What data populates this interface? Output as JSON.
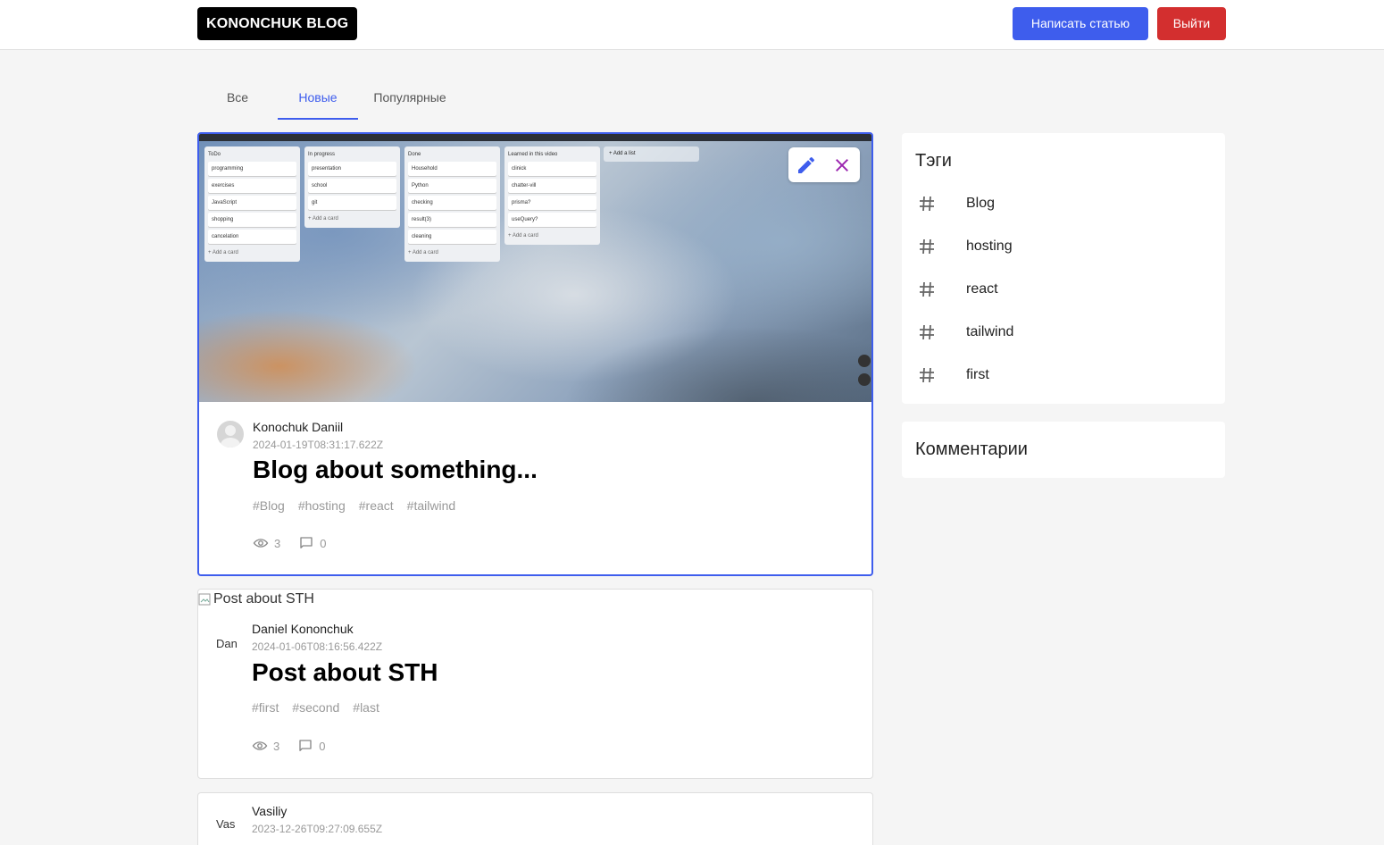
{
  "header": {
    "logo": "KONONCHUK BLOG",
    "write_label": "Написать статью",
    "logout_label": "Выйти"
  },
  "tabs": [
    {
      "label": "Все",
      "active": false
    },
    {
      "label": "Новые",
      "active": true
    },
    {
      "label": "Популярные",
      "active": false
    }
  ],
  "posts": [
    {
      "image_alt": "",
      "author": "Konochuk Daniil",
      "date": "2024-01-19T08:31:17.622Z",
      "title": "Blog about something...",
      "tags": [
        "#Blog",
        "#hosting",
        "#react",
        "#tailwind"
      ],
      "views": "3",
      "comments": "0",
      "avatar_alt": "",
      "trello": [
        {
          "head": "ToDo",
          "cards": [
            "programming",
            "exercises",
            "JavaScript",
            "shopping",
            "cancelation"
          ],
          "add": "+ Add a card"
        },
        {
          "head": "In progress",
          "cards": [
            "presentation",
            "school",
            "git"
          ],
          "add": "+ Add a card"
        },
        {
          "head": "Done",
          "cards": [
            "Household",
            "Python",
            "checking",
            "result(3)",
            "cleaning"
          ],
          "add": "+ Add a card"
        },
        {
          "head": "Learned in this video",
          "cards": [
            "clinick",
            "chatter-vill",
            "prisma?",
            "useQuery?"
          ],
          "add": "+ Add a card"
        }
      ],
      "add_list": "+ Add a list"
    },
    {
      "image_alt": "Post about STH",
      "author": "Daniel Kononchuk",
      "date": "2024-01-06T08:16:56.422Z",
      "title": "Post about STH",
      "tags": [
        "#first",
        "#second",
        "#last"
      ],
      "views": "3",
      "comments": "0",
      "avatar_alt": "Dan"
    },
    {
      "author": "Vasiliy",
      "date": "2023-12-26T09:27:09.655Z",
      "avatar_alt": "Vas"
    }
  ],
  "sidebar": {
    "tags_title": "Тэги",
    "tags": [
      "Blog",
      "hosting",
      "react",
      "tailwind",
      "first"
    ],
    "comments_title": "Комментарии"
  },
  "colors": {
    "accent": "#3e5ded",
    "danger": "#d32f2f",
    "close_icon": "#9c27b0"
  }
}
